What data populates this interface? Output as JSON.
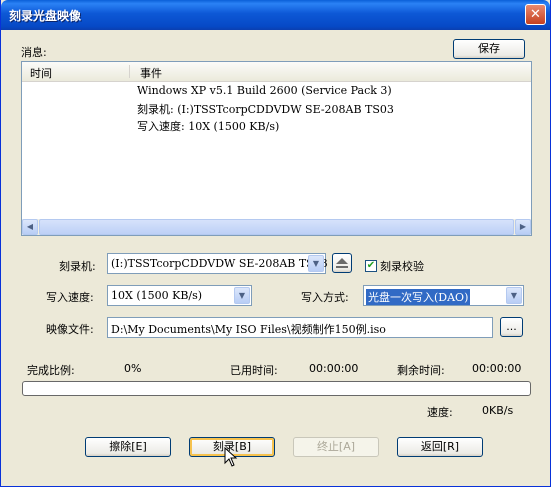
{
  "window": {
    "title": "刻录光盘映像",
    "close_symbol": "✕"
  },
  "messages": {
    "label": "消息:",
    "save_label": "保存",
    "columns": [
      "时间",
      "事件"
    ],
    "rows": [
      {
        "time": "",
        "event": "Windows XP v5.1 Build 2600 (Service Pack 3)"
      },
      {
        "time": "",
        "event": "刻录机: (I:)TSSTcorpCDDVDW SE-208AB TS03"
      },
      {
        "time": "",
        "event": "写入速度: 10X (1500 KB/s)"
      }
    ]
  },
  "burner": {
    "label": "刻录机:",
    "value": "(I:)TSSTcorpCDDVDW SE-208AB TS03",
    "eject_icon": "eject-icon",
    "verify_label": "刻录校验",
    "verify_checked": true
  },
  "speed": {
    "label": "写入速度:",
    "value": "10X (1500 KB/s)"
  },
  "write_mode": {
    "label": "写入方式:",
    "value": "光盘一次写入(DAO)"
  },
  "image_file": {
    "label": "映像文件:",
    "value": "D:\\My Documents\\My ISO Files\\视频制作150例.iso",
    "browse_label": "..."
  },
  "status": {
    "percent_label": "完成比例:",
    "percent_value": "0%",
    "elapsed_label": "已用时间:",
    "elapsed_value": "00:00:00",
    "remaining_label": "剩余时间:",
    "remaining_value": "00:00:00",
    "progress": 0,
    "speed_label": "速度:",
    "speed_value": "0KB/s"
  },
  "buttons": {
    "erase": "擦除[E]",
    "burn": "刻录[B]",
    "stop": "终止[A]",
    "back": "返回[R]"
  },
  "colors": {
    "title_blue": "#0d58d6",
    "selection": "#316ac5",
    "progress": "#2fb32f"
  }
}
